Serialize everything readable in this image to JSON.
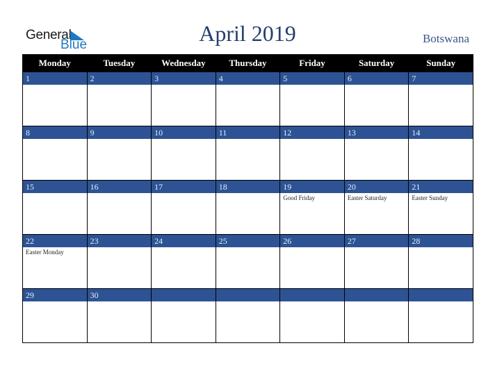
{
  "logo": {
    "word1": "General",
    "word2": "Blue",
    "icon": "triangle-flag-icon",
    "accent": "#1f7ac1"
  },
  "title": "April 2019",
  "country": "Botswana",
  "colors": {
    "header_bg": "#000000",
    "daybar_bg": "#2d5394",
    "title": "#253f6e"
  },
  "weekdays": [
    "Monday",
    "Tuesday",
    "Wednesday",
    "Thursday",
    "Friday",
    "Saturday",
    "Sunday"
  ],
  "weeks": [
    {
      "days": [
        "1",
        "2",
        "3",
        "4",
        "5",
        "6",
        "7"
      ],
      "events": [
        "",
        "",
        "",
        "",
        "",
        "",
        ""
      ]
    },
    {
      "days": [
        "8",
        "9",
        "10",
        "11",
        "12",
        "13",
        "14"
      ],
      "events": [
        "",
        "",
        "",
        "",
        "",
        "",
        ""
      ]
    },
    {
      "days": [
        "15",
        "16",
        "17",
        "18",
        "19",
        "20",
        "21"
      ],
      "events": [
        "",
        "",
        "",
        "",
        "Good Friday",
        "Easter Saturday",
        "Easter Sunday"
      ]
    },
    {
      "days": [
        "22",
        "23",
        "24",
        "25",
        "26",
        "27",
        "28"
      ],
      "events": [
        "Easter Monday",
        "",
        "",
        "",
        "",
        "",
        ""
      ]
    },
    {
      "days": [
        "29",
        "30",
        "",
        "",
        "",
        "",
        ""
      ],
      "events": [
        "",
        "",
        "",
        "",
        "",
        "",
        ""
      ]
    }
  ]
}
